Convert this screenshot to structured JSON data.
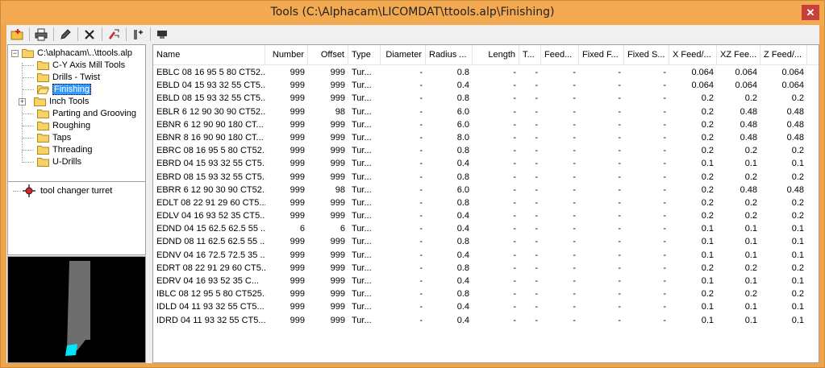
{
  "window": {
    "title": "Tools (C:\\Alphacam\\LICOMDAT\\ttools.alp\\Finishing)",
    "close_glyph": "✕"
  },
  "toolbar": {
    "buttons": [
      {
        "name": "add-folder-icon"
      },
      {
        "name": "print-icon"
      },
      {
        "name": "pencil-icon"
      },
      {
        "name": "delete-icon"
      },
      {
        "name": "tool-properties-icon"
      },
      {
        "name": "tool-assembly-icon"
      },
      {
        "name": "turret-icon"
      }
    ]
  },
  "tree": {
    "root": "C:\\alphacam\\..\\ttools.alp",
    "items": [
      {
        "label": "C-Y Axis Mill Tools"
      },
      {
        "label": "Drills - Twist"
      },
      {
        "label": "Finishing",
        "selected": true
      },
      {
        "label": "Inch Tools",
        "expandable": true
      },
      {
        "label": "Parting and Grooving"
      },
      {
        "label": "Roughing"
      },
      {
        "label": "Taps"
      },
      {
        "label": "Threading"
      },
      {
        "label": "U-Drills"
      }
    ]
  },
  "turret": {
    "label": "tool changer turret"
  },
  "table": {
    "columns": [
      "Name",
      "Number",
      "Offset",
      "Type",
      "Diameter",
      "Radius ...",
      "Length",
      "T...",
      "Feed...",
      "Fixed F...",
      "Fixed S...",
      "X Feed/...",
      "XZ Fee...",
      "Z Feed/..."
    ],
    "rows": [
      [
        "EBLC 08 16 95 5 80 CT52...",
        "999",
        "999",
        "Tur...",
        "-",
        "0.8",
        "-",
        "-",
        "-",
        "-",
        "-",
        "0.064",
        "0.064",
        "0.064"
      ],
      [
        "EBLD 04 15 93 32 55 CT5...",
        "999",
        "999",
        "Tur...",
        "-",
        "0.4",
        "-",
        "-",
        "-",
        "-",
        "-",
        "0.064",
        "0.064",
        "0.064"
      ],
      [
        "EBLD 08 15 93 32 55 CT5...",
        "999",
        "999",
        "Tur...",
        "-",
        "0.8",
        "-",
        "-",
        "-",
        "-",
        "-",
        "0.2",
        "0.2",
        "0.2"
      ],
      [
        "EBLR 6 12 90 30 90 CT52...",
        "999",
        "98",
        "Tur...",
        "-",
        "6.0",
        "-",
        "-",
        "-",
        "-",
        "-",
        "0.2",
        "0.48",
        "0.48"
      ],
      [
        "EBNR 6 12 90 90 180 CT...",
        "999",
        "999",
        "Tur...",
        "-",
        "6.0",
        "-",
        "-",
        "-",
        "-",
        "-",
        "0.2",
        "0.48",
        "0.48"
      ],
      [
        "EBNR 8 16 90 90 180 CT...",
        "999",
        "999",
        "Tur...",
        "-",
        "8.0",
        "-",
        "-",
        "-",
        "-",
        "-",
        "0.2",
        "0.48",
        "0.48"
      ],
      [
        "EBRC 08 16 95 5 80 CT52...",
        "999",
        "999",
        "Tur...",
        "-",
        "0.8",
        "-",
        "-",
        "-",
        "-",
        "-",
        "0.2",
        "0.2",
        "0.2"
      ],
      [
        "EBRD 04 15 93 32 55 CT5...",
        "999",
        "999",
        "Tur...",
        "-",
        "0.4",
        "-",
        "-",
        "-",
        "-",
        "-",
        "0.1",
        "0.1",
        "0.1"
      ],
      [
        "EBRD 08 15 93 32 55 CT5...",
        "999",
        "999",
        "Tur...",
        "-",
        "0.8",
        "-",
        "-",
        "-",
        "-",
        "-",
        "0.2",
        "0.2",
        "0.2"
      ],
      [
        "EBRR 6 12 90 30 90 CT52...",
        "999",
        "98",
        "Tur...",
        "-",
        "6.0",
        "-",
        "-",
        "-",
        "-",
        "-",
        "0.2",
        "0.48",
        "0.48"
      ],
      [
        "EDLT 08 22 91 29 60 CT5...",
        "999",
        "999",
        "Tur...",
        "-",
        "0.8",
        "-",
        "-",
        "-",
        "-",
        "-",
        "0.2",
        "0.2",
        "0.2"
      ],
      [
        "EDLV 04 16 93 52 35 CT5...",
        "999",
        "999",
        "Tur...",
        "-",
        "0.4",
        "-",
        "-",
        "-",
        "-",
        "-",
        "0.2",
        "0.2",
        "0.2"
      ],
      [
        "EDND 04 15 62.5 62.5 55 ...",
        "6",
        "6",
        "Tur...",
        "-",
        "0.4",
        "-",
        "-",
        "-",
        "-",
        "-",
        "0.1",
        "0.1",
        "0.1"
      ],
      [
        "EDND 08 11 62.5 62.5 55 ...",
        "999",
        "999",
        "Tur...",
        "-",
        "0.8",
        "-",
        "-",
        "-",
        "-",
        "-",
        "0.1",
        "0.1",
        "0.1"
      ],
      [
        "EDNV 04 16 72.5 72.5 35 ...",
        "999",
        "999",
        "Tur...",
        "-",
        "0.4",
        "-",
        "-",
        "-",
        "-",
        "-",
        "0.1",
        "0.1",
        "0.1"
      ],
      [
        "EDRT 08 22 91 29 60 CT5...",
        "999",
        "999",
        "Tur...",
        "-",
        "0.8",
        "-",
        "-",
        "-",
        "-",
        "-",
        "0.2",
        "0.2",
        "0.2"
      ],
      [
        "EDRV 04 16 93 52 35    C...",
        "999",
        "999",
        "Tur...",
        "-",
        "0.4",
        "-",
        "-",
        "-",
        "-",
        "-",
        "0.1",
        "0.1",
        "0.1"
      ],
      [
        "IBLC 08 12 95 5 80 CT525...",
        "999",
        "999",
        "Tur...",
        "-",
        "0.8",
        "-",
        "-",
        "-",
        "-",
        "-",
        "0.2",
        "0.2",
        "0.2"
      ],
      [
        "IDLD 04 11 93 32 55 CT5...",
        "999",
        "999",
        "Tur...",
        "-",
        "0.4",
        "-",
        "-",
        "-",
        "-",
        "-",
        "0.1",
        "0.1",
        "0.1"
      ],
      [
        "IDRD 04 11 93 32 55 CT5...",
        "999",
        "999",
        "Tur...",
        "-",
        "0.4",
        "-",
        "-",
        "-",
        "-",
        "-",
        "0.1",
        "0.1",
        "0.1"
      ]
    ]
  },
  "colors": {
    "titlebar": "#f3a94f",
    "selection": "#3399ff",
    "close": "#c7403a",
    "tool_tip": "#00e5ff"
  }
}
